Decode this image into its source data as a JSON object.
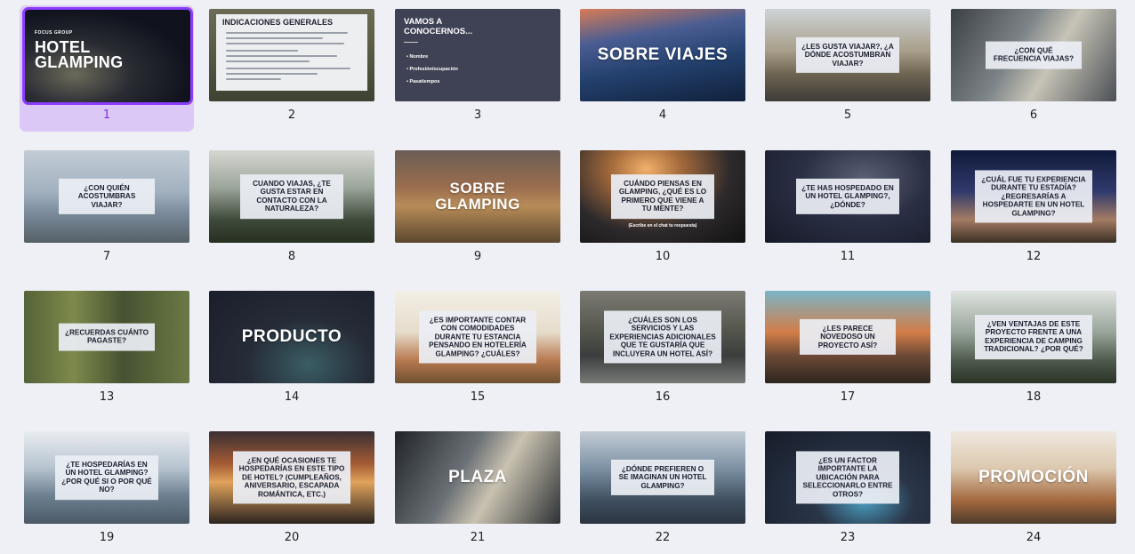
{
  "selected_slide": 1,
  "slides": [
    {
      "num": "1",
      "bg": "bg-night",
      "layout": "s1",
      "brand": "FOCUS GROUP",
      "title_lines": [
        "HOTEL",
        "GLAMPING"
      ]
    },
    {
      "num": "2",
      "bg": "bg-forest",
      "layout": "s2",
      "heading": "INDICACIONES GENERALES"
    },
    {
      "num": "3",
      "bg": "bg-slate",
      "layout": "s3",
      "heading_lines": [
        "VAMOS A",
        "CONOCERNOS..."
      ],
      "items": [
        "• Nombre",
        "• Profesión/ocupación",
        "• Pasatiempos"
      ]
    },
    {
      "num": "4",
      "bg": "bg-wing",
      "layout": "big",
      "title": "SOBRE VIAJES"
    },
    {
      "num": "5",
      "bg": "bg-road",
      "layout": "box",
      "text": "¿LES GUSTA VIAJAR?, ¿A DÓNDE ACOSTUMBRAN VIAJAR?"
    },
    {
      "num": "6",
      "bg": "bg-map",
      "layout": "box",
      "text": "¿CON QUÉ FRECUENCIA VIAJAS?"
    },
    {
      "num": "7",
      "bg": "bg-lake",
      "layout": "box",
      "text": "¿CON QUIÉN ACOSTUMBRAS VIAJAR?"
    },
    {
      "num": "8",
      "bg": "bg-mist",
      "layout": "box",
      "text": "CUANDO VIAJAS, ¿TE GUSTA ESTAR EN CONTACTO CON LA NATURALEZA?"
    },
    {
      "num": "9",
      "bg": "bg-tent",
      "layout": "big",
      "title": "SOBRE GLAMPING"
    },
    {
      "num": "10",
      "bg": "bg-galaxy",
      "layout": "box",
      "text": "CUÁNDO PIENSAS EN GLAMPING, ¿QUÉ ES LO PRIMERO QUE VIENE A TU MENTE?",
      "note": "(Escribe en el chat tu respuesta)"
    },
    {
      "num": "11",
      "bg": "bg-stars",
      "layout": "box",
      "text": "¿TE HAS HOSPEDADO EN UN HOTEL GLAMPING?, ¿DÓNDE?"
    },
    {
      "num": "12",
      "bg": "bg-twilight",
      "layout": "box",
      "text": "¿CUÁL FUE TU EXPERIENCIA DURANTE TU ESTADÍA? ¿REGRESARÍAS A HOSPEDARTE EN UN HOTEL GLAMPING?"
    },
    {
      "num": "13",
      "bg": "bg-bamboo",
      "layout": "box",
      "text": "¿RECUERDAS CUÁNTO PAGASTE?"
    },
    {
      "num": "14",
      "bg": "bg-dark",
      "layout": "big",
      "title": "PRODUCTO"
    },
    {
      "num": "15",
      "bg": "bg-cream",
      "layout": "box",
      "text": "¿ES IMPORTANTE CONTAR CON COMODIDADES DURANTE TU ESTANCIA PENSANDO EN HOTELERÍA GLAMPING? ¿CUÁLES?"
    },
    {
      "num": "16",
      "bg": "bg-wet",
      "layout": "box",
      "text": "¿CUÁLES SON LOS SERVICIOS Y LAS EXPERIENCIAS ADICIONALES QUE TE GUSTARÍA QUE INCLUYERA UN HOTEL ASÍ?"
    },
    {
      "num": "17",
      "bg": "bg-canyon",
      "layout": "box",
      "text": "¿LES PARECE NOVEDOSO UN PROYECTO ASÍ?"
    },
    {
      "num": "18",
      "bg": "bg-hills",
      "layout": "box",
      "text": "¿VEN VENTAJAS DE ESTE PROYECTO FRENTE A UNA EXPERIENCIA DE CAMPING TRADICIONAL? ¿POR QUÉ?"
    },
    {
      "num": "19",
      "bg": "bg-fog",
      "layout": "box",
      "text": "¿TE HOSPEDARÍAS EN UN HOTEL GLAMPING? ¿POR QUÉ SI O POR QUÉ NO?"
    },
    {
      "num": "20",
      "bg": "bg-sunset",
      "layout": "box",
      "text": "¿EN QUÉ OCASIONES TE HOSPEDARÍAS EN ESTE TIPO DE HOTEL? (CUMPLEAÑOS, ANIVERSARIO, ESCAPADA ROMÁNTICA, ETC.)"
    },
    {
      "num": "21",
      "bg": "bg-car",
      "layout": "big",
      "title": "PLAZA"
    },
    {
      "num": "22",
      "bg": "bg-dusk",
      "layout": "box",
      "text": "¿DÓNDE PREFIEREN O SE IMAGINAN UN HOTEL GLAMPING?"
    },
    {
      "num": "23",
      "bg": "bg-night2",
      "layout": "box",
      "text": "¿ES UN FACTOR IMPORTANTE LA UBICACIÓN PARA SELECCIONARLO ENTRE OTROS?"
    },
    {
      "num": "24",
      "bg": "bg-warm",
      "layout": "big",
      "title": "PROMOCIÓN"
    }
  ]
}
